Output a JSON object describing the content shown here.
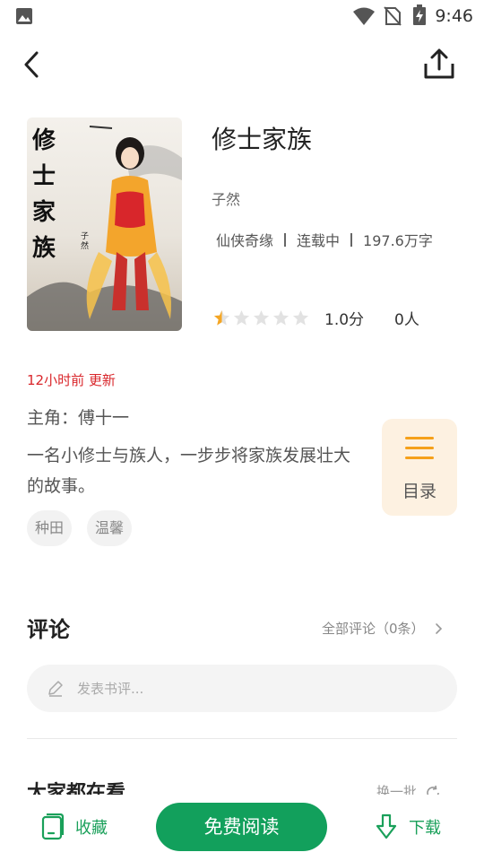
{
  "status_bar": {
    "time": "9:46"
  },
  "book": {
    "title": "修士家族",
    "author": "子然",
    "genre": "仙侠奇缘",
    "status": "连载中",
    "word_count": "197.6万字",
    "rating": 1.0,
    "rating_score": "1.0分",
    "rating_count": "0人",
    "update_time": "12小时前 更新",
    "protagonist": "主角：傅十一",
    "synopsis": "一名小修士与族人，一步步将家族发展壮大的故事。",
    "tags": [
      "种田",
      "温馨"
    ],
    "cover": {
      "title_text": "修士家族",
      "author_text": "子然"
    }
  },
  "toc": {
    "label": "目录"
  },
  "comments": {
    "title": "评论",
    "all_label": "全部评论（0条）",
    "placeholder": "发表书评..."
  },
  "recommend": {
    "title": "大家都在看",
    "refresh_label": "换一批"
  },
  "bottom_bar": {
    "collect_label": "收藏",
    "read_label": "免费阅读",
    "download_label": "下载"
  },
  "colors": {
    "accent": "#12a05c",
    "update_red": "#d9262b",
    "star": "#f5a623",
    "toc_bg": "#fdf1e1"
  }
}
